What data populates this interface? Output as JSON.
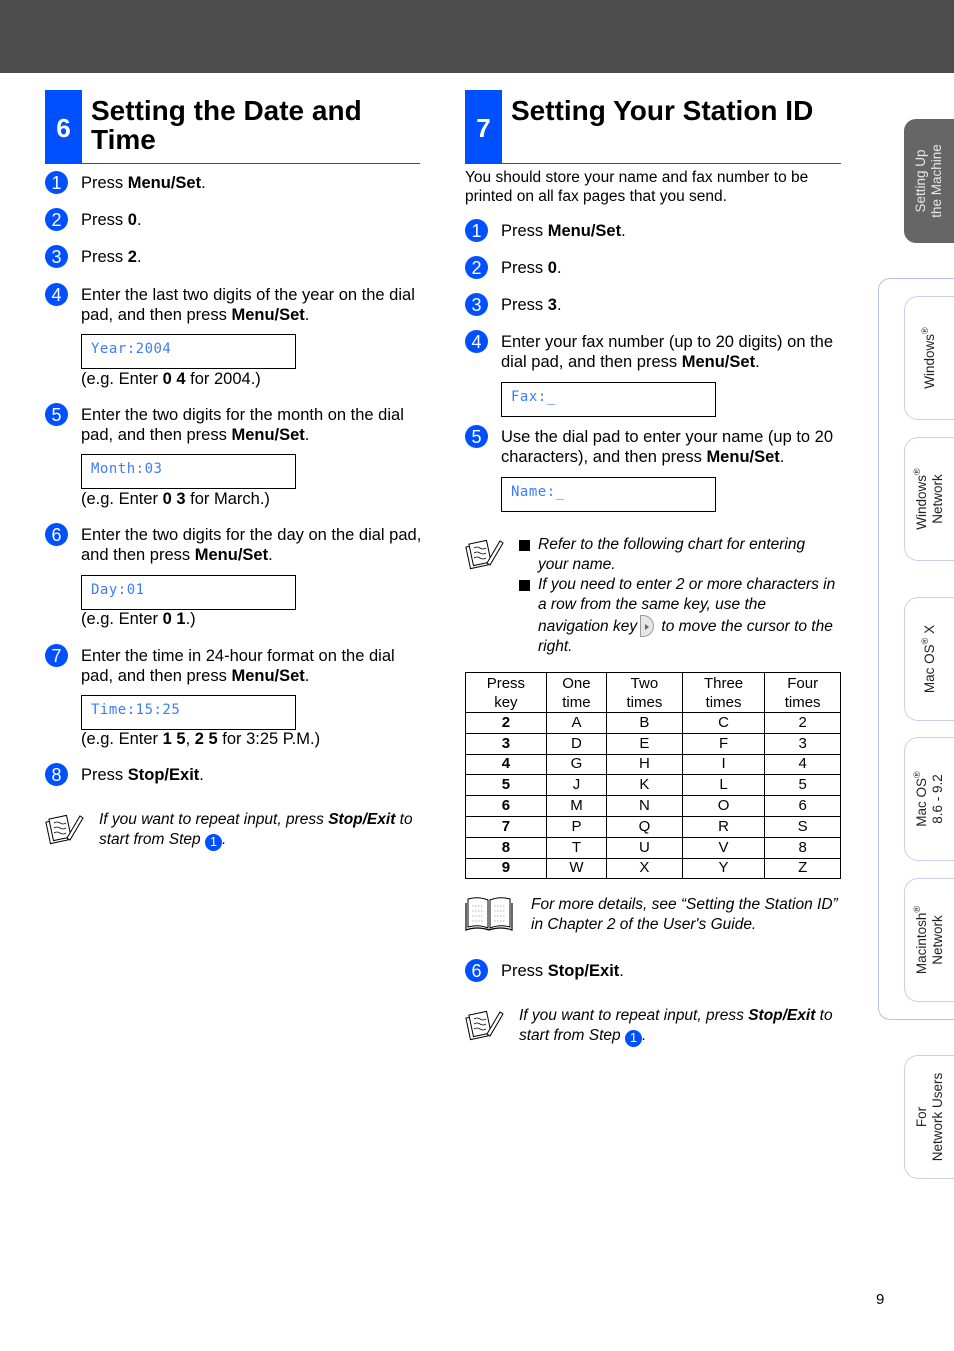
{
  "header_bar": {
    "color": "#4d4d4d"
  },
  "accent_color": "#0050ff",
  "lcd_text_color": "#3d7cff",
  "section_left": {
    "number": "6",
    "title_line1": "Setting the Date and",
    "title_line2": "Time",
    "steps": [
      {
        "n": "1",
        "pre": "Press ",
        "bold": "Menu/Set",
        "post": "."
      },
      {
        "n": "2",
        "pre": "Press ",
        "bold": "0",
        "post": "."
      },
      {
        "n": "3",
        "pre": "Press ",
        "bold": "2",
        "post": "."
      },
      {
        "n": "4",
        "pre": "Enter the last two digits of the year on the dial pad, and then press ",
        "bold": "Menu/Set",
        "post": ".",
        "lcd": "Year:2004",
        "eg_pre": "(e.g. Enter ",
        "eg_bold": "0 4",
        "eg_post": " for 2004.)"
      },
      {
        "n": "5",
        "pre": "Enter the two digits for the month on the dial pad, and then press ",
        "bold": "Menu/Set",
        "post": ".",
        "lcd": "Month:03",
        "eg_pre": "(e.g. Enter ",
        "eg_bold": "0 3",
        "eg_post": " for March.)"
      },
      {
        "n": "6",
        "pre": "Enter the two digits for the day on the dial pad, and then press ",
        "bold": "Menu/Set",
        "post": ".",
        "lcd": "Day:01",
        "eg_pre": "(e.g. Enter ",
        "eg_bold": "0 1",
        "eg_post": ".)"
      },
      {
        "n": "7",
        "pre": "Enter the time in 24-hour format on the dial pad, and then press ",
        "bold": "Menu/Set",
        "post": ".",
        "lcd": "Time:15:25",
        "eg_pre": "(e.g. Enter ",
        "eg_bold": "1 5",
        "eg_mid": ", ",
        "eg_bold2": "2 5",
        "eg_post": " for 3:25 P.M.)"
      },
      {
        "n": "8",
        "pre": "Press ",
        "bold": "Stop/Exit",
        "post": "."
      }
    ],
    "note": {
      "pre": "If you want to repeat input, press ",
      "bold": "Stop/Exit",
      "mid": " to start from Step ",
      "step_ref": "1",
      "post": ".",
      "icon": "note-pencil-icon"
    }
  },
  "section_right": {
    "number": "7",
    "title": "Setting Your Station ID",
    "intro": "You should store your name and fax number to be printed on all fax pages that you send.",
    "steps": [
      {
        "n": "1",
        "pre": "Press ",
        "bold": "Menu/Set",
        "post": "."
      },
      {
        "n": "2",
        "pre": "Press ",
        "bold": "0",
        "post": "."
      },
      {
        "n": "3",
        "pre": "Press ",
        "bold": "3",
        "post": "."
      },
      {
        "n": "4",
        "pre": "Enter your fax number (up to 20 digits) on the dial pad, and then press ",
        "bold": "Menu/Set",
        "post": ".",
        "lcd": "Fax:_"
      },
      {
        "n": "5",
        "pre": "Use the dial pad to enter your name (up to 20 characters), and then press ",
        "bold": "Menu/Set",
        "post": ".",
        "lcd": "Name:_"
      },
      {
        "n": "6",
        "pre": "Press ",
        "bold": "Stop/Exit",
        "post": "."
      }
    ],
    "tips": {
      "icon": "note-pencil-icon",
      "items": [
        "Refer to the following chart for entering your name.",
        {
          "pre": "If you need to enter 2 or more characters in a row from the same key, use the navigation key",
          "post": " to move the cursor to the right.",
          "key_icon": "navigation-right-key-icon"
        }
      ]
    },
    "table": {
      "headers": [
        [
          "Press",
          "key"
        ],
        [
          "One",
          "time"
        ],
        [
          "Two",
          "times"
        ],
        [
          "Three",
          "times"
        ],
        [
          "Four",
          "times"
        ]
      ],
      "rows": [
        [
          "2",
          "A",
          "B",
          "C",
          "2"
        ],
        [
          "3",
          "D",
          "E",
          "F",
          "3"
        ],
        [
          "4",
          "G",
          "H",
          "I",
          "4"
        ],
        [
          "5",
          "J",
          "K",
          "L",
          "5"
        ],
        [
          "6",
          "M",
          "N",
          "O",
          "6"
        ],
        [
          "7",
          "P",
          "Q",
          "R",
          "S"
        ],
        [
          "8",
          "T",
          "U",
          "V",
          "8"
        ],
        [
          "9",
          "W",
          "X",
          "Y",
          "Z"
        ]
      ]
    },
    "reference": {
      "icon": "open-book-icon",
      "text": "For more details, see “Setting the Station ID” in Chapter 2 of the User's Guide."
    },
    "note": {
      "pre": "If you want to repeat input, press ",
      "bold": "Stop/Exit",
      "mid": " to start from Step ",
      "step_ref": "1",
      "post": ".",
      "icon": "note-pencil-icon"
    }
  },
  "side_tabs": [
    {
      "line1": "Setting Up",
      "line2": "the Machine",
      "active": true
    },
    {
      "line1": "Windows",
      "sup": "®",
      "line2": "",
      "active": false
    },
    {
      "line1": "Windows",
      "sup": "®",
      "line2": "Network",
      "active": false
    },
    {
      "line1": "Mac OS",
      "sup": "®",
      "suffix": " X",
      "line2": "",
      "active": false
    },
    {
      "line1": "Mac OS",
      "sup": "®",
      "line2": "8.6 - 9.2",
      "active": false
    },
    {
      "line1": "Macintosh",
      "sup": "®",
      "line2": "Network",
      "active": false
    },
    {
      "line1": "For",
      "line2": "Network Users",
      "active": false
    }
  ],
  "page_number": "9"
}
